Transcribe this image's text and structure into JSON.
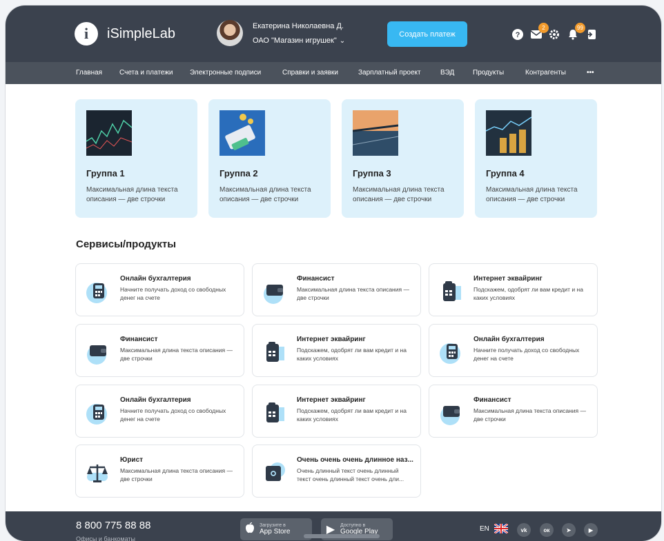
{
  "header": {
    "app_name": "iSimpleLab",
    "logo_letter": "i",
    "user_name": "Екатерина Николаевна Д.",
    "company": "ОАО \"Магазин игрушек\"",
    "create_payment_label": "Создать платеж",
    "help_glyph": "?",
    "mail_badge": "2",
    "notifications_badge": "99",
    "icons": [
      "help-icon",
      "mail-icon",
      "gear-icon",
      "bell-icon",
      "logout-icon"
    ],
    "accent_color": "#38b8f2",
    "badge_color": "#f39b2c"
  },
  "nav": {
    "items": [
      "Главная",
      "Счета и платежи",
      "Электронные подписи",
      "Справки и заявки",
      "Зарплатный проект",
      "ВЭД",
      "Продукты",
      "Контрагенты",
      "•••"
    ]
  },
  "groups": [
    {
      "title": "Группа 1",
      "description": "Максимальная длина текста описания — две строчки",
      "image": "stock-chart-image"
    },
    {
      "title": "Группа 2",
      "description": "Максимальная длина текста описания — две строчки",
      "image": "card-terminal-image"
    },
    {
      "title": "Группа 3",
      "description": "Максимальная длина текста описания — две строчки",
      "image": "city-bridge-image"
    },
    {
      "title": "Группа 4",
      "description": "Максимальная длина текста описания — две строчки",
      "image": "coins-chart-image"
    }
  ],
  "services": {
    "title": "Сервисы/продукты",
    "items": [
      {
        "title": "Онлайн бухгалтерия",
        "description": "Начните получать доход со свободных денег на счете",
        "icon": "calculator-icon"
      },
      {
        "title": "Финансист",
        "description": "Максимальная длина текста описания — две строчки",
        "icon": "wallet-icon"
      },
      {
        "title": "Интернет эквайринг",
        "description": "Подскажем, одобрят ли вам кредит и на каких условиях",
        "icon": "pos-terminal-icon"
      },
      {
        "title": "Финансист",
        "description": "Максимальная длина текста описания — две строчки",
        "icon": "wallet-icon"
      },
      {
        "title": "Интернет эквайринг",
        "description": "Подскажем, одобрят ли вам кредит и на каких условиях",
        "icon": "pos-terminal-icon"
      },
      {
        "title": "Онлайн бухгалтерия",
        "description": "Начните получать доход со свободных денег на счете",
        "icon": "calculator-icon"
      },
      {
        "title": "Онлайн бухгалтерия",
        "description": "Начните получать доход со свободных денег на счете",
        "icon": "calculator-icon"
      },
      {
        "title": "Интернет эквайринг",
        "description": "Подскажем, одобрят ли вам кредит и на каких условиях",
        "icon": "pos-terminal-icon"
      },
      {
        "title": "Финансист",
        "description": "Максимальная длина текста описания — две строчки",
        "icon": "wallet-icon"
      },
      {
        "title": "Юрист",
        "description": "Максимальная длина текста описания — две строчки",
        "icon": "scales-icon"
      },
      {
        "title": "Очень очень очень длинное наз...",
        "description": "Очень длинный текст очень длинный текст очень длинный текст очень дли...",
        "icon": "safe-icon"
      }
    ]
  },
  "footer": {
    "phone": "8 800 775 88 88",
    "phone_hint": "Офисы и банкоматы",
    "app_store_small": "Загрузите в",
    "app_store_large": "App Store",
    "google_play_small": "Доступно в",
    "google_play_large": "Google Play",
    "language": "EN",
    "socials": [
      "vk-icon",
      "ok-icon",
      "telegram-icon",
      "youtube-icon"
    ],
    "social_glyphs": [
      "vk",
      "ок",
      "➤",
      "▶"
    ]
  }
}
